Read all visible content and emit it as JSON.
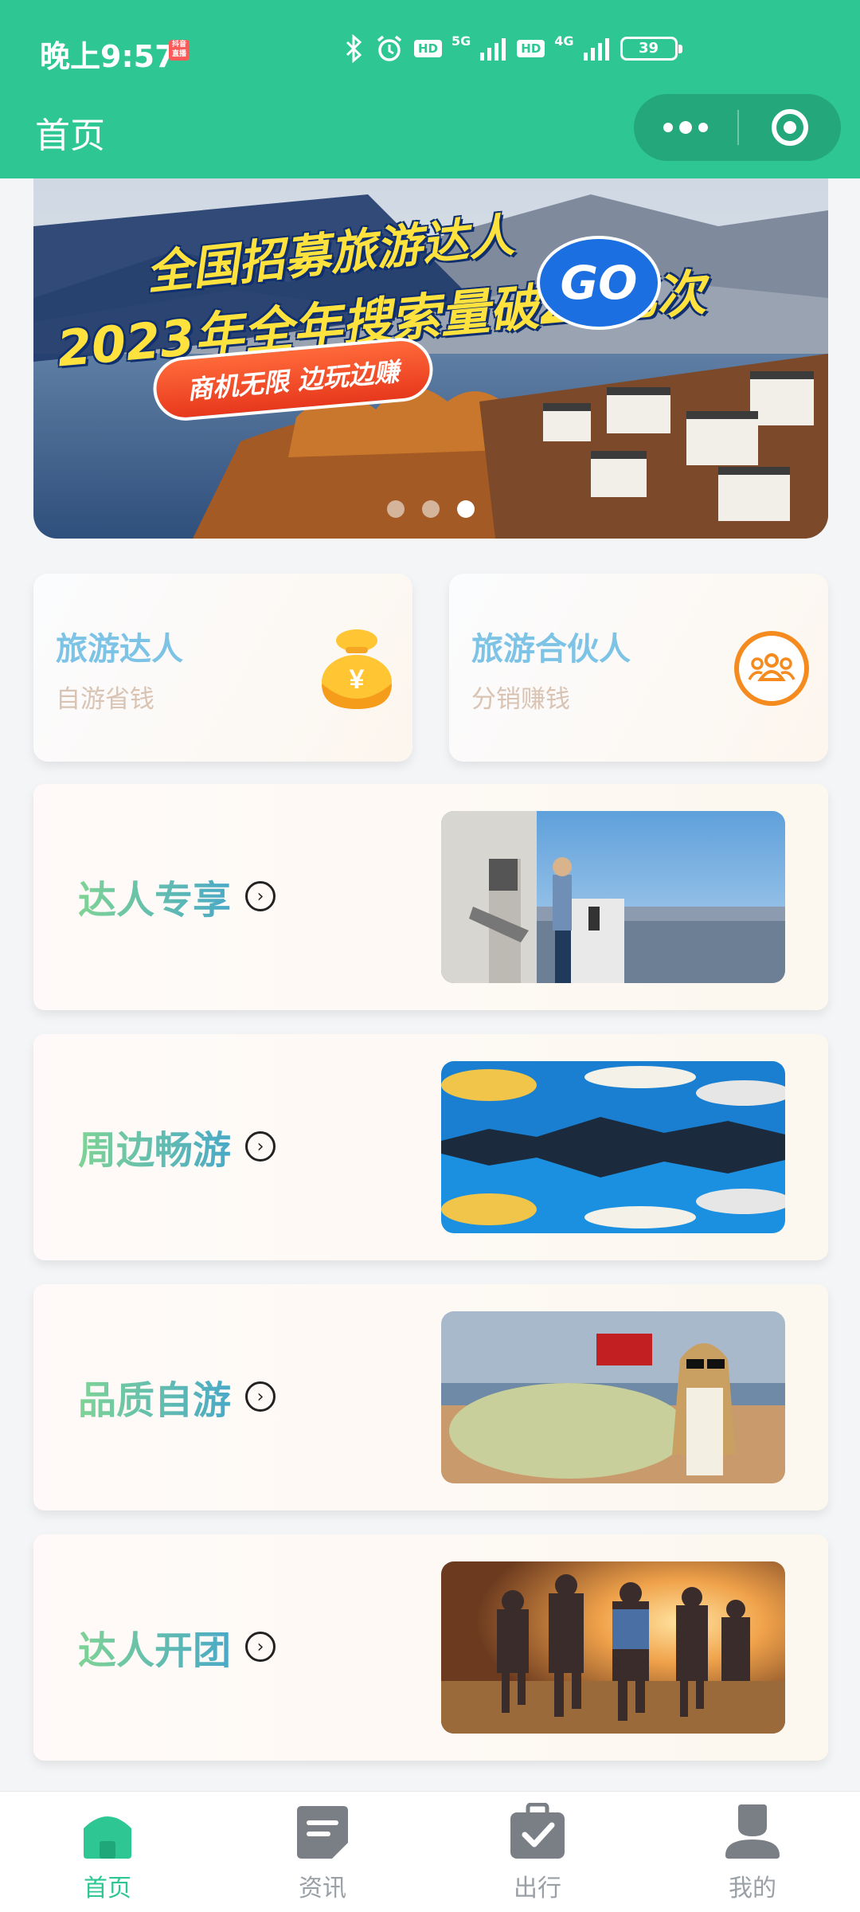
{
  "status_bar": {
    "time": "晚上9:57",
    "badge": "抖音直播",
    "network1": "5G",
    "network2": "4G",
    "hd1": "HD",
    "hd2": "HD",
    "battery": "39"
  },
  "nav": {
    "title": "首页"
  },
  "banner": {
    "line1": "全国招募旅游达人",
    "line2": "2023年全年搜索量破27亿次",
    "go": "GO",
    "pill": "商机无限 边玩边赚",
    "active_index": 2,
    "dot_count": 3
  },
  "roles": [
    {
      "title": "旅游达人",
      "subtitle": "自游省钱",
      "icon": "money-bag-icon"
    },
    {
      "title": "旅游合伙人",
      "subtitle": "分销赚钱",
      "icon": "partner-group-icon"
    }
  ],
  "features": [
    {
      "label": "达人专享",
      "image": "observation-deck-photo"
    },
    {
      "label": "周边畅游",
      "image": "mirror-lake-photo"
    },
    {
      "label": "品质自游",
      "image": "road-trip-photo"
    },
    {
      "label": "达人开团",
      "image": "group-running-photo"
    }
  ],
  "tabbar": {
    "items": [
      {
        "label": "首页",
        "icon": "home-icon",
        "active": true
      },
      {
        "label": "资讯",
        "icon": "news-icon",
        "active": false
      },
      {
        "label": "出行",
        "icon": "suitcase-check-icon",
        "active": false
      },
      {
        "label": "我的",
        "icon": "profile-icon",
        "active": false
      }
    ]
  },
  "colors": {
    "brand": "#2ec794",
    "tab_inactive": "#9aa0a6",
    "role_title": "#7cc3e6",
    "partner_orange": "#f58b1f"
  }
}
